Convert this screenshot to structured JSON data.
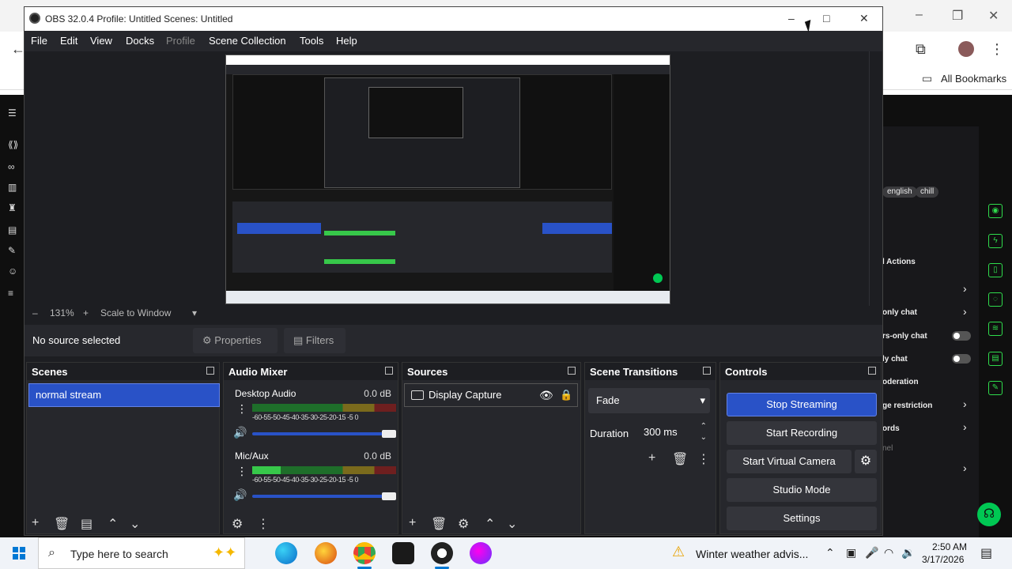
{
  "window": {
    "title": "OBS 32.0.4   Profile: Untitled   Scenes: Untitled",
    "minimize": "–",
    "maximize": "□",
    "close": "✕"
  },
  "menu": [
    "File",
    "Edit",
    "View",
    "Docks",
    "Profile",
    "Scene Collection",
    "Tools",
    "Help"
  ],
  "zoom": {
    "minus": "–",
    "level": "131%",
    "plus": "+",
    "mode": "Scale to Window",
    "dropdown": "▾"
  },
  "source_bar": {
    "no_source": "No source selected",
    "properties": "Properties",
    "filters": "Filters"
  },
  "scenes": {
    "title": "Scenes",
    "items": [
      "normal stream"
    ]
  },
  "audio_mixer": {
    "title": "Audio Mixer",
    "channels": [
      {
        "name": "Desktop Audio",
        "db": "0.0 dB",
        "scale": "-60-55-50-45-40-35-30-25-20-15 -5 0",
        "level": 0
      },
      {
        "name": "Mic/Aux",
        "db": "0.0 dB",
        "scale": "-60-55-50-45-40-35-30-25-20-15 -5 0",
        "level": 0.2
      }
    ]
  },
  "sources": {
    "title": "Sources",
    "items": [
      "Display Capture"
    ]
  },
  "scene_transitions": {
    "title": "Scene Transitions",
    "transition": "Fade",
    "duration_label": "Duration",
    "duration": "300 ms"
  },
  "controls": {
    "title": "Controls",
    "stop_streaming": "Stop Streaming",
    "start_recording": "Start Recording",
    "start_virtual_camera": "Start Virtual Camera",
    "studio_mode": "Studio Mode",
    "settings": "Settings"
  },
  "background_browser": {
    "bookmarks": "All Bookmarks",
    "tags": [
      "english",
      "chill"
    ],
    "actions_title": "l Actions",
    "rows": [
      "only chat",
      "rs-only chat",
      "ly chat",
      "oderation",
      "ge restriction",
      "ords",
      "nel"
    ]
  },
  "taskbar": {
    "search_placeholder": "Type here to search",
    "weather": "Winter weather advis...",
    "time": "2:50 AM",
    "date": "3/17/2026"
  },
  "colors": {
    "accent": "#2952c7",
    "obs_bg": "#1d1e22",
    "dock_bg": "#26272c",
    "meter_green": "#37c84a"
  }
}
